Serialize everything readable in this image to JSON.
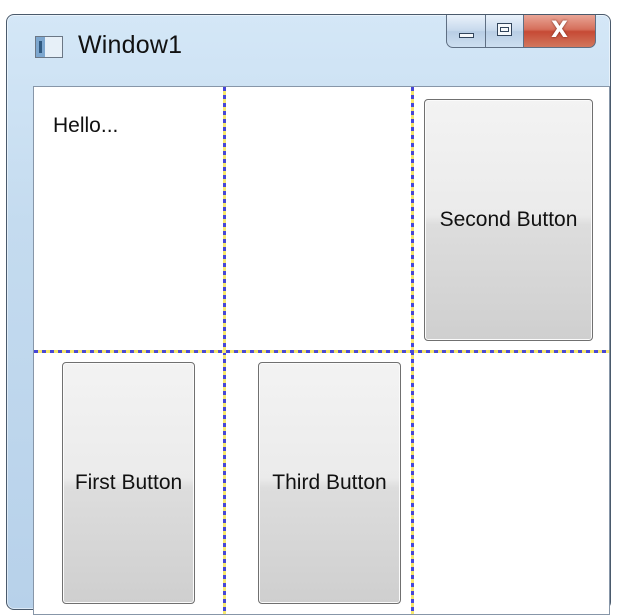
{
  "window": {
    "title": "Window1",
    "caption_buttons": {
      "minimize_icon": "minimize-icon",
      "maximize_icon": "maximize-icon",
      "close_icon": "close-icon",
      "close_glyph": "X"
    }
  },
  "content": {
    "hello_text": "Hello...",
    "buttons": {
      "first": "First Button",
      "second": "Second Button",
      "third": "Third Button"
    },
    "grid_line_colors": {
      "primary": "#4646d6",
      "secondary": "#f6e86d"
    }
  },
  "colors": {
    "title_bar": "#c4dbef",
    "close_button": "#c64a35",
    "client_background": "#ffffff",
    "button_face": "#e8e8e8"
  }
}
